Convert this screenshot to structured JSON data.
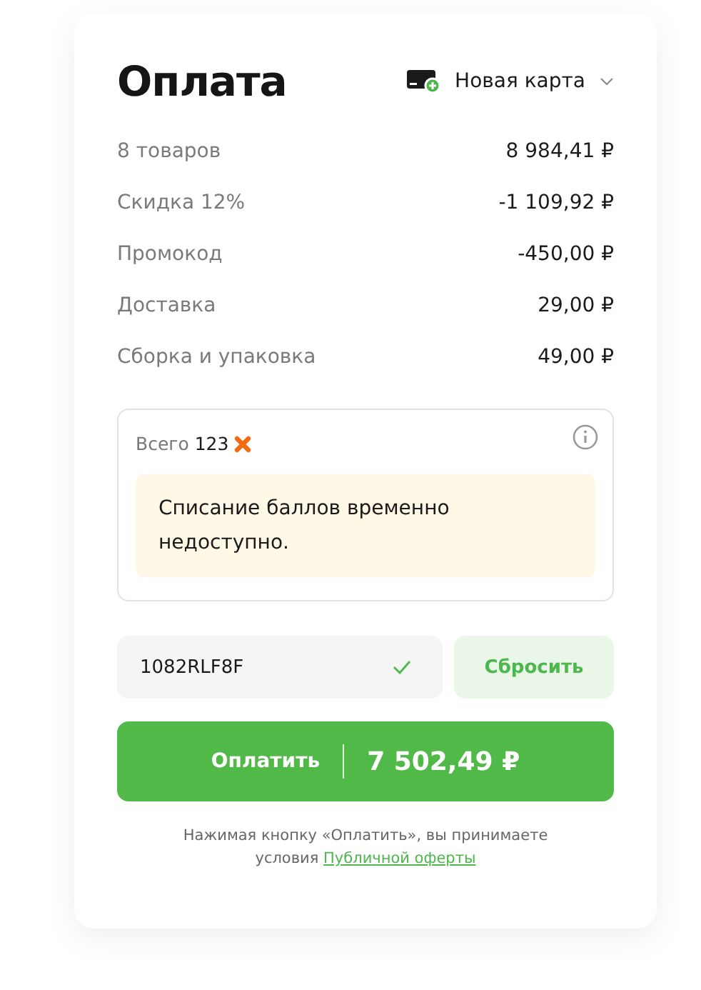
{
  "title": "Оплата",
  "card_selector": {
    "label": "Новая карта"
  },
  "summary": [
    {
      "label": "8 товаров",
      "value": "8 984,41 ₽"
    },
    {
      "label": "Скидка 12%",
      "value": "-1 109,92 ₽"
    },
    {
      "label": "Промокод",
      "value": "-450,00 ₽"
    },
    {
      "label": "Доставка",
      "value": "29,00 ₽"
    },
    {
      "label": "Сборка и упаковка",
      "value": "49,00 ₽"
    }
  ],
  "points": {
    "total": "Всего **123**",
    "notice": "Списание баллов временно недоступно."
  },
  "promo": {
    "value": "1082RLF8F",
    "valid": true,
    "reset_button": "Сбросить"
  },
  "pay_button": {
    "label": "Оплатить",
    "amount": "7 502,49 ₽"
  },
  "legal": {
    "text": "Нажимая кнопку «Оплатить», вы принимаете условия",
    "link": "Публичной оферты"
  }
}
